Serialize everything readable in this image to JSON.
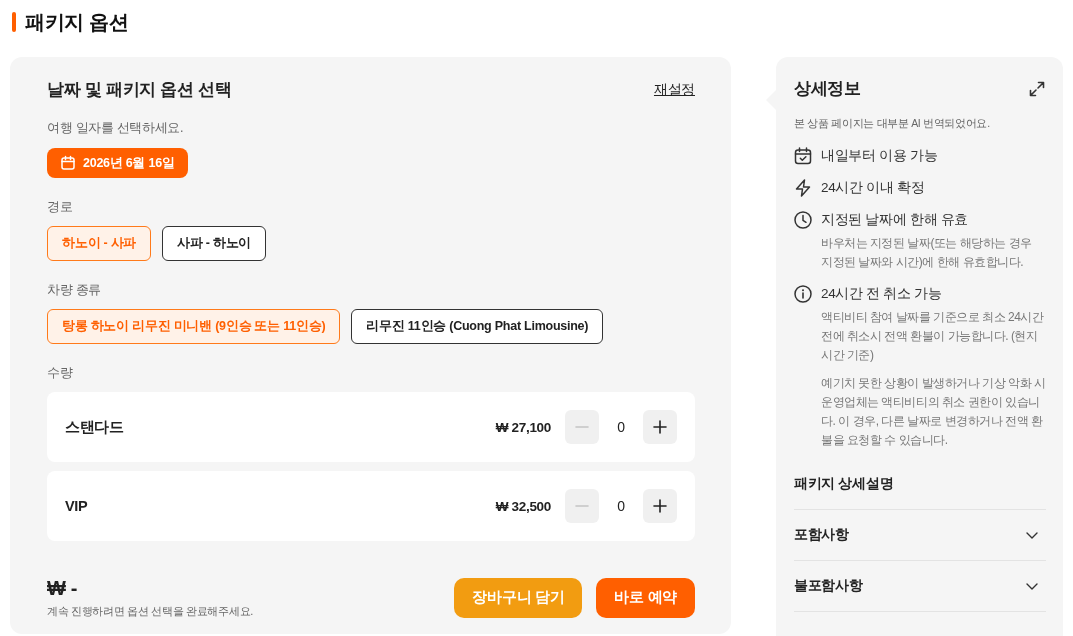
{
  "page_title": "패키지 옵션",
  "options_panel": {
    "title": "날짜 및 패키지 옵션 선택",
    "reset_link": "재설정",
    "date": {
      "label": "여행 일자를 선택하세요.",
      "value": "2026년 6월 16일"
    },
    "route": {
      "label": "경로",
      "options": [
        {
          "label": "하노이 - 사파",
          "selected": true
        },
        {
          "label": "사파 - 하노이",
          "selected": false
        }
      ]
    },
    "vehicle": {
      "label": "차량 종류",
      "options": [
        {
          "label": "탕롱 하노이 리무진 미니밴 (9인승 또는 11인승)",
          "selected": true
        },
        {
          "label": "리무진 11인승 (Cuong Phat Limousine)",
          "selected": false
        }
      ]
    },
    "quantity": {
      "label": "수량",
      "items": [
        {
          "name": "스탠다드",
          "price": "₩ 27,100",
          "count": "0",
          "decrease_disabled": true
        },
        {
          "name": "VIP",
          "price": "₩ 32,500",
          "count": "0",
          "decrease_disabled": true
        }
      ]
    },
    "total": {
      "amount": "₩ -",
      "note": "계속 진행하려면 옵션 선택을 완료해주세요."
    },
    "buttons": [
      {
        "label": "장바구니 담기",
        "kind": "cart"
      },
      {
        "label": "바로 예약",
        "kind": "book"
      }
    ]
  },
  "details_panel": {
    "title": "상세정보",
    "note": "본 상품 페이지는 대부분 AI 번역되었어요.",
    "features": [
      {
        "title": "내일부터 이용 가능"
      },
      {
        "title": "24시간 이내 확정"
      },
      {
        "title": "지정된 날짜에 한해 유효",
        "paragraphs": [
          "바우처는 지정된 날짜(또는 해당하는 경우 지정된 날짜와 시간)에 한해 유효합니다."
        ]
      },
      {
        "title": "24시간 전 취소 가능",
        "paragraphs": [
          "액티비티 참여 날짜를 기준으로 최소 24시간 전에 취소시 전액 환불이 가능합니다. (현지 시간 기준)",
          "예기치 못한 상황이 발생하거나 기상 악화 시 운영업체는 액티비티의 취소 권한이 있습니다. 이 경우, 다른 날짜로 변경하거나 전액 환불을 요청할 수 있습니다."
        ]
      }
    ],
    "package_heading": "패키지 상세설명",
    "sections": [
      {
        "label": "포함사항",
        "expanded": false
      },
      {
        "label": "불포함사항",
        "expanded": false
      }
    ]
  }
}
